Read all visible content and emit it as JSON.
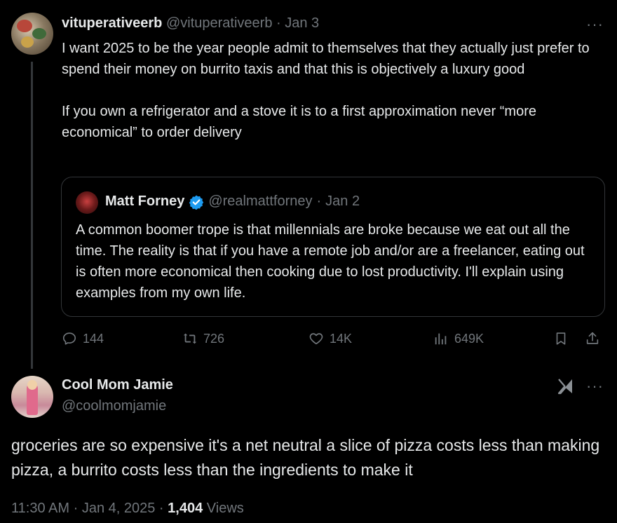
{
  "tweet1": {
    "display_name": "vituperativeerb",
    "handle": "@vituperativeerb",
    "separator": "·",
    "date": "Jan 3",
    "more_label": "···",
    "paragraphs": [
      "I want 2025 to be the year people admit to themselves that they actually just prefer to spend their money on burrito taxis and that this is objectively a luxury good",
      "If you own a refrigerator and a stove it is to a first approximation never “more economical” to order delivery"
    ]
  },
  "quote": {
    "display_name": "Matt Forney",
    "handle": "@realmattforney",
    "separator": "·",
    "date": "Jan 2",
    "text": "A common boomer trope is that millennials are broke because we eat out all the time. The reality is that if you have a remote job and/or are a freelancer, eating out is often more economical then cooking due to lost productivity. I'll explain using examples from my own life."
  },
  "actions": {
    "replies": "144",
    "reposts": "726",
    "likes": "14K",
    "views": "649K"
  },
  "tweet2": {
    "display_name": "Cool Mom Jamie",
    "handle": "@coolmomjamie",
    "more_label": "···",
    "text": "groceries are so expensive it's a net neutral a slice of pizza costs less than making pizza, a burrito costs less than the ingredients to make it",
    "time": "11:30 AM",
    "date": "Jan 4, 2025",
    "separator": "·",
    "views_count": "1,404",
    "views_label": "Views"
  },
  "colors": {
    "background": "#000000",
    "text": "#e7e9ea",
    "muted": "#71767b",
    "border": "#333639",
    "verified": "#1d9bf0"
  }
}
